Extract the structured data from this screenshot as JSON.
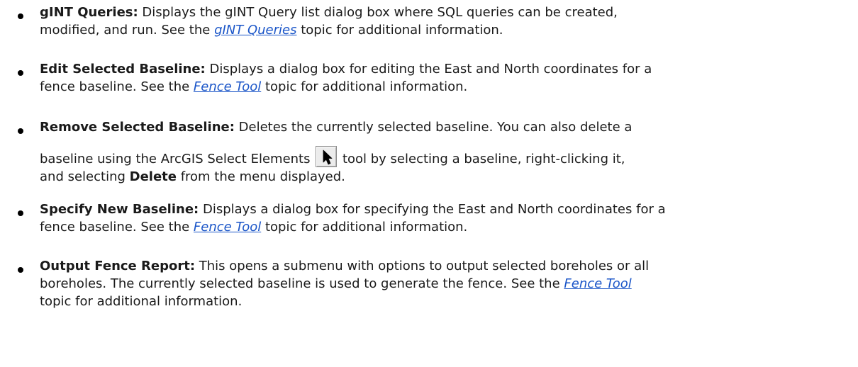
{
  "items": [
    {
      "term": "gINT Queries:",
      "line1": " Displays the gINT Query list dialog box where SQL queries can be created,",
      "line2_pre": "modified, and run. See the ",
      "link": "gINT Queries",
      "line2_post": " topic for additional information."
    },
    {
      "term": "Edit Selected Baseline:",
      "line1": " Displays a dialog box for editing the East and North coordinates for a",
      "line2_pre": "fence baseline. See the ",
      "link": "Fence Tool",
      "line2_post": " topic for additional information."
    },
    {
      "term": "Remove Selected Baseline:",
      "line1": " Deletes the currently selected baseline. You can also delete a",
      "line2_pre": "baseline using the ArcGIS Select Elements ",
      "icon": "select-elements-arrow-icon",
      "line2_post": " tool by selecting a baseline, right-clicking it,",
      "line3_pre": "and selecting ",
      "line3_bold": "Delete",
      "line3_post": " from the menu displayed."
    },
    {
      "term": "Specify New Baseline:",
      "line1": " Displays a dialog box for specifying the East and North coordinates for a",
      "line2_pre": "fence baseline. See the ",
      "link": "Fence Tool",
      "line2_post": " topic for additional information."
    },
    {
      "term": "Output Fence Report:",
      "line1": " This opens a submenu with options to output selected boreholes or all",
      "line2": "boreholes. The currently selected baseline is used to generate the fence. See the ",
      "link": "Fence Tool",
      "line3": "topic for additional information."
    }
  ],
  "colors": {
    "link": "#1a55c8",
    "text": "#1a1a1a"
  }
}
